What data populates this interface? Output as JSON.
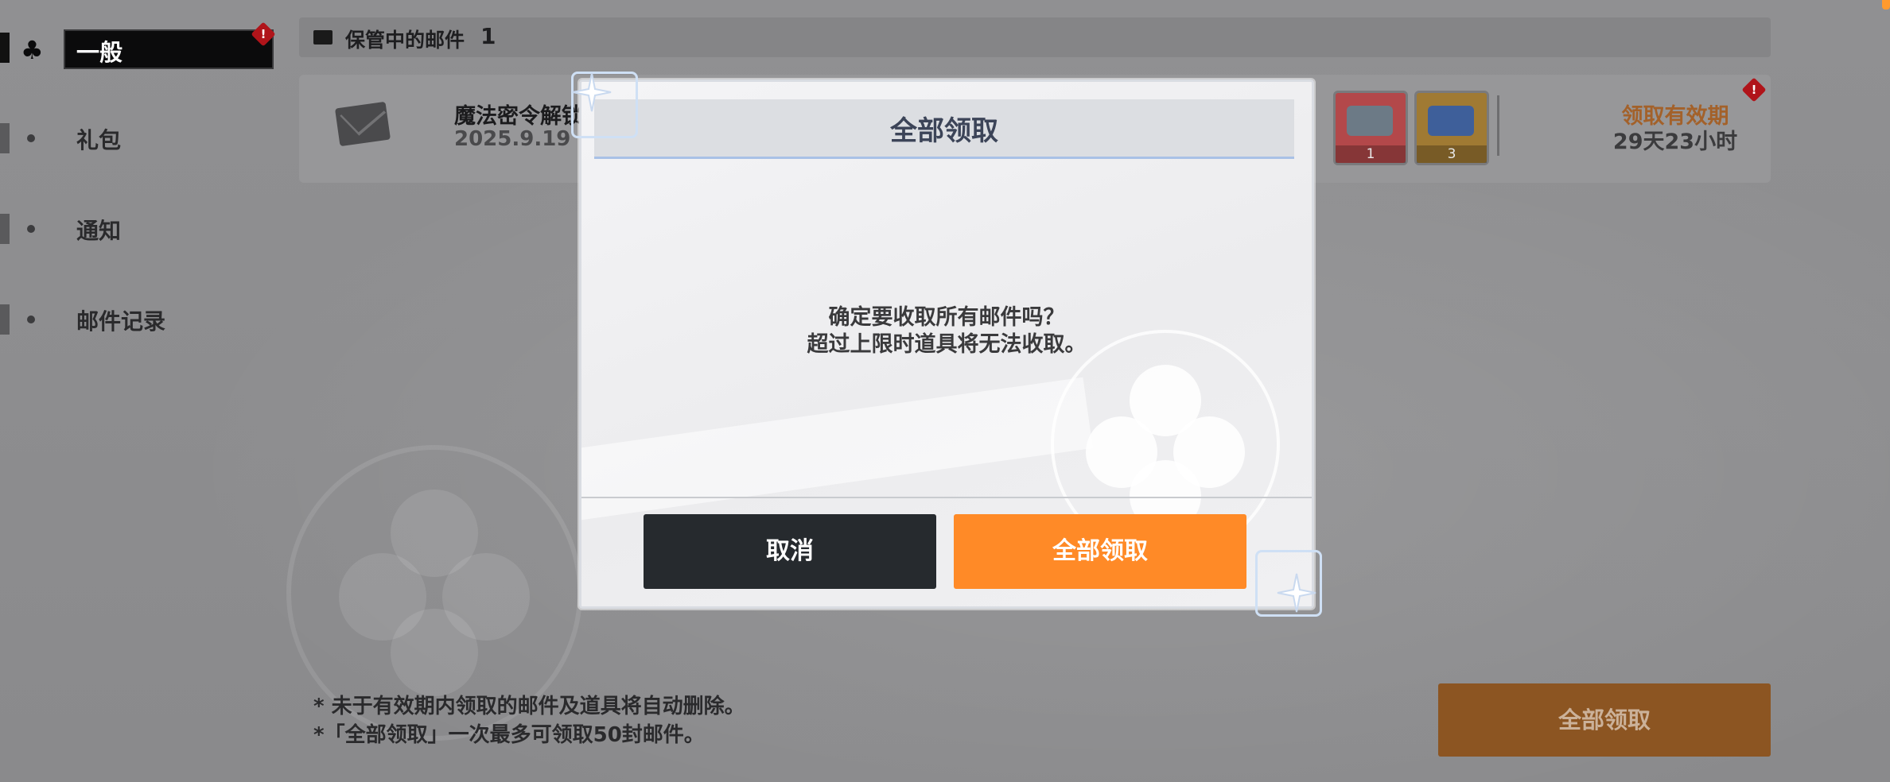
{
  "sidebar": {
    "items": [
      {
        "label": "一般",
        "active": true
      },
      {
        "label": "礼包"
      },
      {
        "label": "通知"
      },
      {
        "label": "邮件记录"
      }
    ]
  },
  "mail_header": {
    "title": "保管中的邮件",
    "count": "1"
  },
  "mail_row": {
    "subject": "魔法密令解锁",
    "date": "2025.9.19",
    "items": [
      {
        "icon": "ticket-mask-icon",
        "qty": "1",
        "color": "#b3484a"
      },
      {
        "icon": "ticket-blue-icon",
        "qty": "3",
        "color": "#a07a33"
      }
    ],
    "expire_label": "领取有效期",
    "expire_time": "29天23小时"
  },
  "footer": {
    "note1": "* 未于有效期内领取的邮件及道具将自动删除。",
    "note2": "*「全部领取」一次最多可领取50封邮件。",
    "claim_all": "全部领取"
  },
  "dialog": {
    "title": "全部领取",
    "message_line1": "确定要收取所有邮件吗？",
    "message_line2": "超过上限时道具将无法收取。",
    "cancel": "取消",
    "confirm": "全部领取"
  },
  "colors": {
    "accent": "#ff8a27",
    "dark_button": "#262a2e",
    "badge_red": "#b0141a"
  }
}
